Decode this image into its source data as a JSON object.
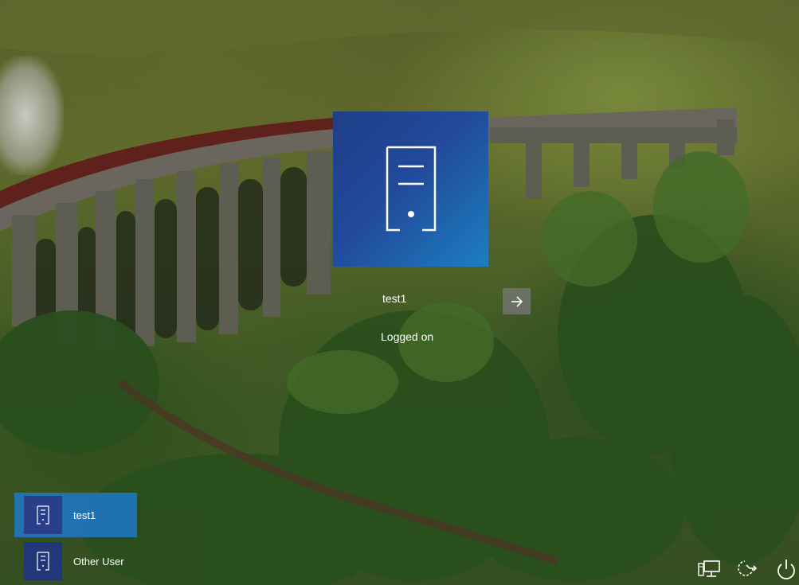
{
  "lock_screen": {
    "selected_user": {
      "name": "test1",
      "status": "Logged on",
      "avatar_icon": "server-icon"
    },
    "submit_icon": "arrow-right-icon"
  },
  "user_list": [
    {
      "name": "test1",
      "selected": true,
      "icon": "server-icon"
    },
    {
      "name": "Other User",
      "selected": false,
      "icon": "server-icon"
    }
  ],
  "corner_controls": [
    {
      "icon": "network-icon"
    },
    {
      "icon": "ease-of-access-icon"
    },
    {
      "icon": "power-icon"
    }
  ],
  "colors": {
    "tile_gradient_start": "#1f3f88",
    "tile_gradient_end": "#1c7fc0",
    "selection": "#1e78c8"
  }
}
